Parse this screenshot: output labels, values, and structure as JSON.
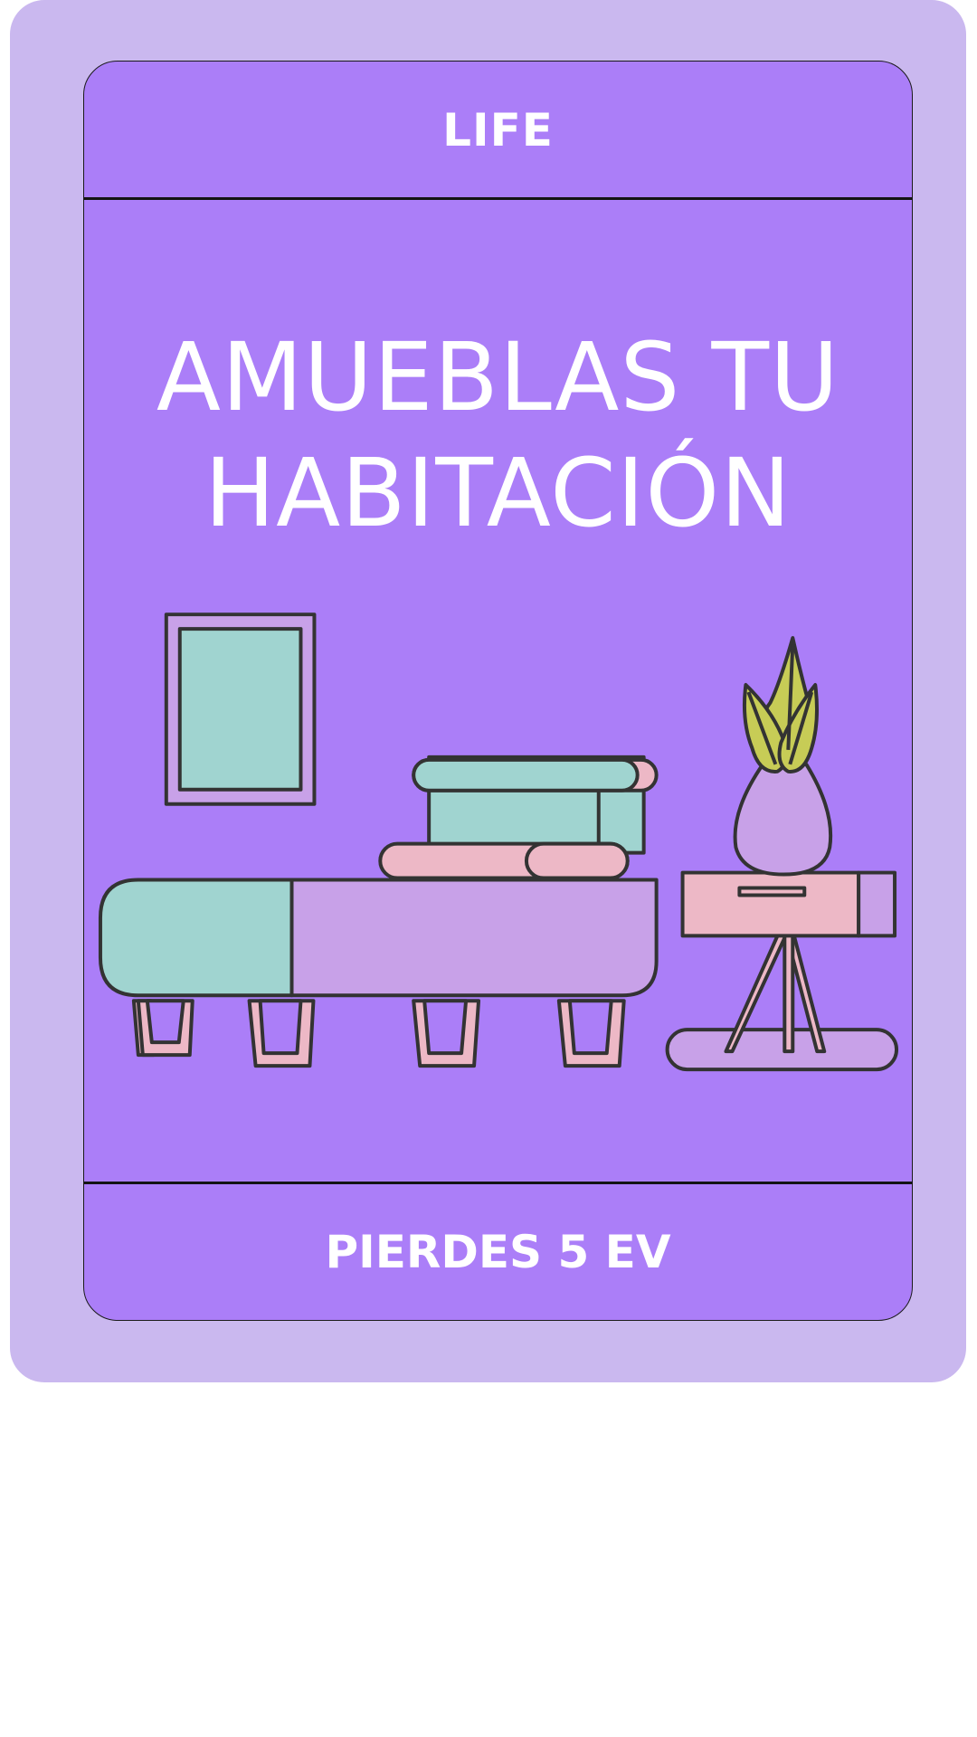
{
  "card": {
    "category": "LIFE",
    "title_lines": [
      "AMUEBLAS TU",
      "HABITACIÓN"
    ],
    "effect": "PIERDES 5 EV"
  },
  "illustration": {
    "subject": "room-furniture-illustration",
    "icons": [
      "picture-frame-icon",
      "bench-icon",
      "stacked-pillows-icon",
      "side-table-icon",
      "potted-plant-icon",
      "rug-icon"
    ]
  },
  "colors": {
    "frame": "#cab8ef",
    "card": "#ab7ef8",
    "teal": "#a0d4d0",
    "lavender": "#c8a1e8",
    "pink": "#edb8c6",
    "leaf": "#c7cc56",
    "outline": "#333333",
    "text": "#ffffff"
  }
}
